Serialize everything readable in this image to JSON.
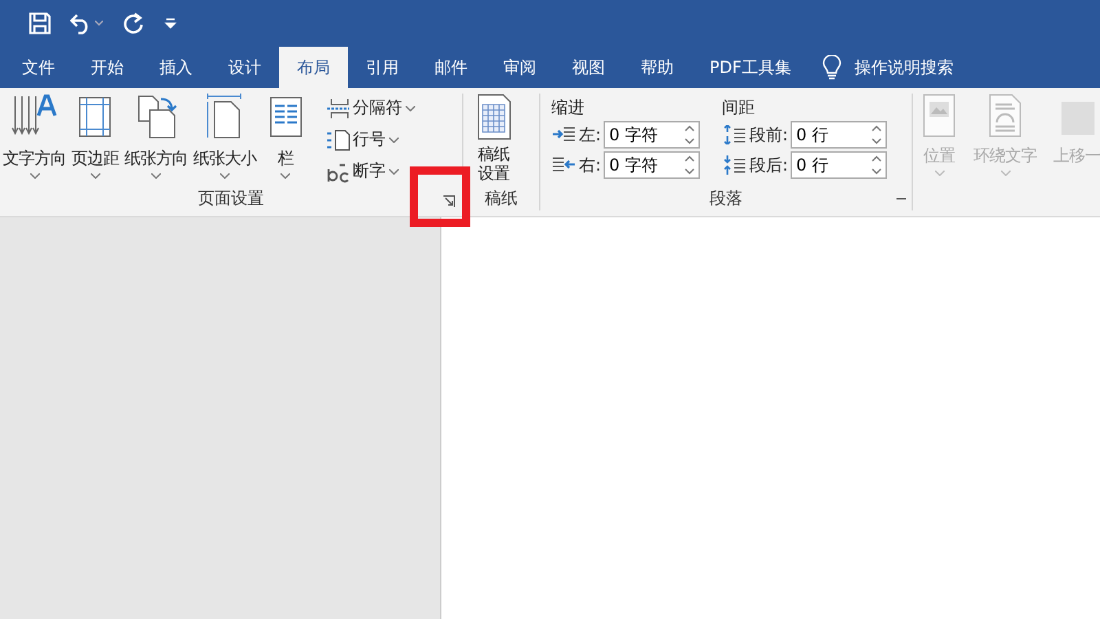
{
  "tabs": [
    {
      "label": "文件",
      "selected": false
    },
    {
      "label": "开始",
      "selected": false
    },
    {
      "label": "插入",
      "selected": false
    },
    {
      "label": "设计",
      "selected": false
    },
    {
      "label": "布局",
      "selected": true
    },
    {
      "label": "引用",
      "selected": false
    },
    {
      "label": "邮件",
      "selected": false
    },
    {
      "label": "审阅",
      "selected": false
    },
    {
      "label": "视图",
      "selected": false
    },
    {
      "label": "帮助",
      "selected": false
    },
    {
      "label": "PDF工具集",
      "selected": false
    }
  ],
  "search": {
    "label": "操作说明搜索"
  },
  "page_setup": {
    "label": "页面设置",
    "highlighted": true,
    "large_buttons": [
      {
        "kind": "text-direction",
        "label": "文字方向",
        "dropdown": true
      },
      {
        "kind": "margins",
        "label": "页边距",
        "dropdown": true
      },
      {
        "kind": "orientation",
        "label": "纸张方向",
        "dropdown": true
      },
      {
        "kind": "size",
        "label": "纸张大小",
        "dropdown": true
      },
      {
        "kind": "columns",
        "label": "栏",
        "dropdown": true
      }
    ],
    "small_buttons": [
      {
        "kind": "breaks",
        "label": "分隔符",
        "dropdown": true
      },
      {
        "kind": "line-numbers",
        "label": "行号",
        "dropdown": true
      },
      {
        "kind": "hyphenation",
        "label": "断字",
        "dropdown": true
      }
    ]
  },
  "manuscript": {
    "label": "稿纸",
    "button": [
      "稿纸",
      "设置"
    ]
  },
  "paragraph": {
    "label": "段落",
    "indent_label": "缩进",
    "spacing_label": "间距",
    "indent": [
      {
        "kind": "left",
        "label": "左:",
        "value": "0 字符"
      },
      {
        "kind": "right",
        "label": "右:",
        "value": "0 字符"
      }
    ],
    "spacing": [
      {
        "kind": "before",
        "label": "段前:",
        "value": "0 行"
      },
      {
        "kind": "after",
        "label": "段后:",
        "value": "0 行"
      }
    ]
  },
  "arrange": {
    "disabled": true,
    "buttons": [
      {
        "kind": "position",
        "label": "位置"
      },
      {
        "kind": "wrap",
        "label": "环绕文字"
      },
      {
        "kind": "forward",
        "label": "上移一"
      }
    ]
  }
}
